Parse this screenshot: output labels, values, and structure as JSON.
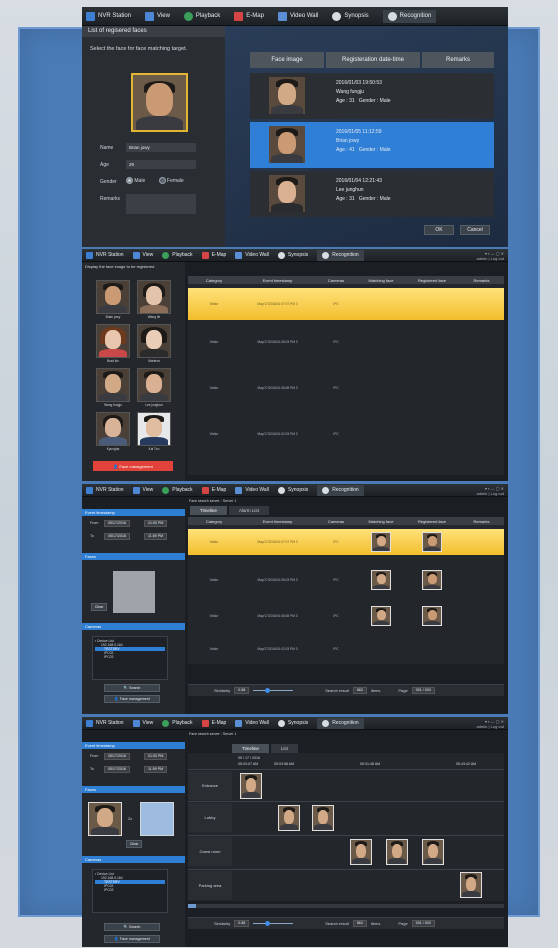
{
  "app": {
    "name": "NVR Station"
  },
  "nav": [
    "View",
    "Playback",
    "E-Map",
    "Video Wall",
    "Synopsis",
    "Recognition"
  ],
  "panel1": {
    "left_title": "List of regisered faces",
    "instruction": "Select the face for face matching target.",
    "fields": {
      "name_label": "Name",
      "name_value": "Brian jowy",
      "age_label": "Age",
      "age_value": "29",
      "gender_label": "Gender",
      "male": "Male",
      "female": "Female",
      "remarks_label": "Remarks"
    },
    "table_headers": [
      "Face image",
      "Registeration date-time",
      "Remarks"
    ],
    "rows": [
      {
        "datetime": "2016/01/03  19:50:53",
        "name": "Wang fungju",
        "age": "Age : 31",
        "gender": "Gender : Male",
        "selected": false
      },
      {
        "datetime": "2016/01/05  11:12:59",
        "name": "Brian jowy",
        "age": "Age : 41",
        "gender": "Gender : Male",
        "selected": true
      },
      {
        "datetime": "2016/01/04  12:21:43",
        "name": "Lee junghun",
        "age": "Age : 31",
        "gender": "Gender : Male",
        "selected": false
      }
    ],
    "ok": "OK",
    "cancel": "Cancel"
  },
  "panel2": {
    "sidebar_title": "Display the face image to be registered",
    "faces": [
      "Brian jowy",
      "Wang fei",
      "Brad kin",
      "Marlena",
      "Wang fungju",
      "Lee junghun",
      "Kyungha",
      "Kai Tzu"
    ],
    "manage_button": "Face management",
    "headers": [
      "Category",
      "Event timestamp",
      "Cameras",
      "Matching face",
      "Registered face",
      "Remarks"
    ],
    "rows": [
      {
        "category": "Visitor",
        "timestamp": "May/17/2016/01:07:07  PM  3",
        "camera": "IPC"
      },
      {
        "category": "Visitor",
        "timestamp": "May/17/2016/01:08:03  PM  3",
        "camera": "IPC"
      },
      {
        "category": "Visitor",
        "timestamp": "May/17/2016/01:08:08  PM  3",
        "camera": "IPC"
      },
      {
        "category": "Visitor",
        "timestamp": "May/17/2016/01:02:03  PM  3",
        "camera": "IPC"
      }
    ],
    "user": "admin  |  Log out"
  },
  "panel3": {
    "server": "Face search server : Server 1",
    "sections": {
      "event": "Event timestamp",
      "faces": "Faces",
      "cameras": "Cameras"
    },
    "from_label": "From",
    "to_label": "To",
    "from_date": "05/17/2016",
    "from_time": "01:00 PM",
    "to_date": "05/17/2016",
    "to_time": "11:59 PM",
    "clear": "Clear",
    "device_list": "Device List",
    "devices": [
      "192.168.0.164",
      "TESTSRV",
      "IPC02",
      "IPC03"
    ],
    "search": "Search",
    "manage": "Face management",
    "tabs": [
      "Timeline",
      "Alarm List"
    ],
    "headers": [
      "Category",
      "Event timestamp",
      "Cameras",
      "Matching face",
      "Registered face",
      "Remarks"
    ],
    "rows": [
      {
        "category": "Visitor",
        "timestamp": "May/17/2016/01:07:07  PM  3",
        "camera": "IPC"
      },
      {
        "category": "Visitor",
        "timestamp": "May/17/2016/01:08:03  PM  3",
        "camera": "IPC"
      },
      {
        "category": "Visitor",
        "timestamp": "May/17/2016/01:08:08  PM  3",
        "camera": "IPC"
      },
      {
        "category": "Visitor",
        "timestamp": "May/17/2016/01:02:03  PM  3",
        "camera": "IPC"
      }
    ],
    "similarity_label": "Similarity",
    "similarity_value": "0.58",
    "search_result_label": "Search result",
    "search_result_value": "663",
    "items": "items",
    "page_label": "Page",
    "page_value": "001 / 003"
  },
  "panel4": {
    "server": "Face search server : Server 1",
    "tabs": [
      "Timeline",
      "List"
    ],
    "date": "05 / 17 / 2016",
    "times": [
      "05:03:07  AM",
      "05:03:58  AM",
      "05:31:48  AM",
      "05:43:42  AM"
    ],
    "lanes": [
      "Entrance",
      "Lobby",
      "Guest room",
      "Parking area"
    ],
    "similarity_value": "0.58",
    "search_result_value": "663",
    "page_value": "001 / 003"
  },
  "colors": {
    "accent": "#2f7fd7",
    "highlight": "#f2bd2c",
    "background": "#4a7bb7",
    "panel": "#1b1e22"
  }
}
